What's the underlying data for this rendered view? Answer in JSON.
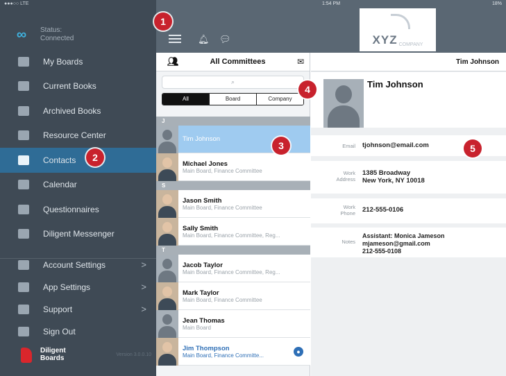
{
  "statusbar": {
    "carrier": "●●●○○ LTE",
    "time": "1:54 PM",
    "battery": "18%"
  },
  "sidebar": {
    "status_label": "Status:",
    "status_value": "Connected",
    "items": [
      {
        "label": "My Boards",
        "icon": "boards-icon"
      },
      {
        "label": "Current Books",
        "icon": "book-icon"
      },
      {
        "label": "Archived Books",
        "icon": "archive-icon"
      },
      {
        "label": "Resource Center",
        "icon": "folder-icon"
      },
      {
        "label": "Contacts",
        "icon": "contacts-icon",
        "active": true
      },
      {
        "label": "Calendar",
        "icon": "calendar-icon"
      },
      {
        "label": "Questionnaires",
        "icon": "questionnaire-icon"
      },
      {
        "label": "Diligent Messenger",
        "icon": "messenger-icon"
      }
    ],
    "settings": [
      {
        "label": "Account Settings",
        "icon": "person-icon"
      },
      {
        "label": "App Settings",
        "icon": "gear-icon"
      },
      {
        "label": "Support",
        "icon": "phone-icon"
      },
      {
        "label": "Sign Out",
        "icon": "sign-out-icon"
      }
    ],
    "brand_line1": "Diligent",
    "brand_line2": "Boards",
    "version": "Version 3.0.0.10"
  },
  "topbar": {
    "logo_text": "XYZ",
    "logo_sub": "COMPANY"
  },
  "list": {
    "title": "All Committees",
    "search_placeholder": "Search",
    "segments": [
      "All",
      "Board",
      "Company"
    ],
    "sections": [
      {
        "letter": "J",
        "contacts": [
          {
            "name": "Tim Johnson",
            "sub": "",
            "selected": true,
            "photo": false
          },
          {
            "name": "Michael Jones",
            "sub": "Main Board, Finance Committee",
            "photo": true
          }
        ]
      },
      {
        "letter": "S",
        "contacts": [
          {
            "name": "Jason Smith",
            "sub": "Main Board, Finance Committee",
            "photo": true
          },
          {
            "name": "Sally Smith",
            "sub": "Main Board, Finance Committee, Reg...",
            "photo": true
          }
        ]
      },
      {
        "letter": "T",
        "contacts": [
          {
            "name": "Jacob Taylor",
            "sub": "Main Board, Finance Committee, Reg...",
            "photo": false
          },
          {
            "name": "Mark Taylor",
            "sub": "Main Board, Finance Committee",
            "photo": true
          },
          {
            "name": "Jean Thomas",
            "sub": "Main Board",
            "photo": false
          },
          {
            "name": "Jim Thompson",
            "sub": "Main Board, Finance Committe...",
            "photo": true,
            "highlight": true
          }
        ]
      }
    ]
  },
  "detail": {
    "header": "Tim Johnson",
    "name": "Tim Johnson",
    "email_label": "Email",
    "email": "tjohnson@email.com",
    "work_address_label": "Work Address",
    "work_address": "1385 Broadway\nNew York, NY 10018",
    "work_phone_label": "Work Phone",
    "work_phone": "212-555-0106",
    "notes_label": "Notes",
    "notes": "Assistant: Monica Jameson\nmjameson@gmail.com\n212-555-0108"
  },
  "callouts": [
    "1",
    "2",
    "3",
    "4",
    "5"
  ],
  "colors": {
    "sidebar": "#3f4a55",
    "active": "#2f6c96",
    "callout": "#c8222d",
    "selected_row": "#9fcbf0"
  }
}
